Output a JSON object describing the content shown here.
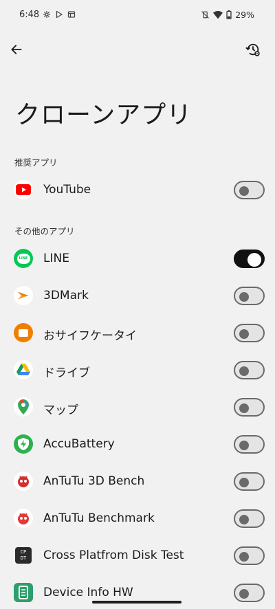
{
  "status_bar": {
    "time": "6:48",
    "battery": "29%"
  },
  "page": {
    "title": "クローンアプリ"
  },
  "sections": {
    "recommended": "推奨アプリ",
    "other": "その他のアプリ"
  },
  "recommended_apps": [
    {
      "label": "YouTube",
      "enabled": false,
      "icon": "youtube-icon"
    }
  ],
  "other_apps": [
    {
      "label": "LINE",
      "enabled": true,
      "icon": "line-icon"
    },
    {
      "label": "3DMark",
      "enabled": false,
      "icon": "3dmark-icon"
    },
    {
      "label": "おサイフケータイ",
      "enabled": false,
      "icon": "osaifu-keitai-icon"
    },
    {
      "label": "ドライブ",
      "enabled": false,
      "icon": "drive-icon"
    },
    {
      "label": "マップ",
      "enabled": false,
      "icon": "maps-icon"
    },
    {
      "label": "AccuBattery",
      "enabled": false,
      "icon": "accubattery-icon"
    },
    {
      "label": "AnTuTu 3D Bench",
      "enabled": false,
      "icon": "antutu-3d-icon"
    },
    {
      "label": "AnTuTu Benchmark",
      "enabled": false,
      "icon": "antutu-icon"
    },
    {
      "label": "Cross Platfrom Disk Test",
      "enabled": false,
      "icon": "cpdt-icon"
    },
    {
      "label": "Device Info HW",
      "enabled": false,
      "icon": "device-info-icon"
    }
  ],
  "icon_badges": {
    "line": "LINE",
    "cpdt_top": "CP",
    "cpdt_bottom": "DT"
  },
  "colors": {
    "background": "#f1f1f1",
    "toggle_on": "#111111",
    "toggle_off_track": "#e4e4e4",
    "toggle_off_border": "#6a6a6a"
  }
}
